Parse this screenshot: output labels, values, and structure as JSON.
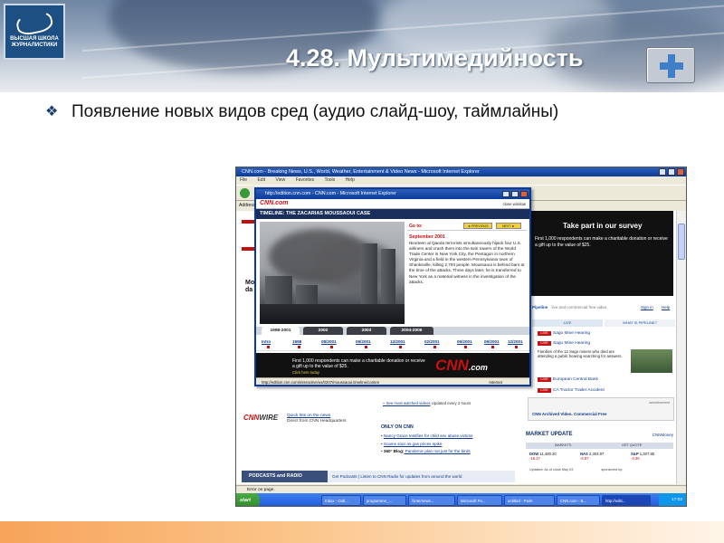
{
  "slide": {
    "logo_text": "ВЫСШАЯ ШКОЛА ЖУРНАЛИСТИКИ",
    "title": "4.28. Мультимедийность",
    "bullet_glyph": "❖",
    "bullet": "Появление новых видов сред (аудио слайд-шоу, таймлайны)"
  },
  "browser": {
    "title": "CNN.com - Breaking News, U.S., World, Weather, Entertainment & Video News - Microsoft Internet Explorer",
    "menu": [
      "File",
      "Edit",
      "View",
      "Favorites",
      "Tools",
      "Help"
    ],
    "address_label": "Address",
    "status": "Error on page."
  },
  "background_page": {
    "headline": "Mo da",
    "survey": {
      "title": "Take part in our survey",
      "text": "First 1,000 respondents can make a charitable donation or receive a gift up to the value of $25."
    },
    "pipeline": {
      "brand": "Pipeline",
      "tagline": "live and commercial free video",
      "signin": "Sign in",
      "help": "Help",
      "tab_live": "LIVE",
      "tab_what": "WHAT IS PIPELINE?",
      "items": [
        {
          "badge": "LIVE",
          "label": "Sago Mine Hearing"
        },
        {
          "badge": "LIVE",
          "label": "Sago Mine Hearing"
        },
        {
          "badge": "LIVE",
          "label": "European Central Bank"
        },
        {
          "badge": "LIVE",
          "label": "CA Tractor Trailer Accident"
        }
      ],
      "description": "Families of the 12 Sago miners who died are attending a public hearing searching for answers."
    },
    "archived": {
      "sponsored": "advertisement",
      "label": "CNN Archived Video. Commercial Free"
    },
    "market": {
      "title": "MARKET UPDATE",
      "link": "CNNMoney",
      "tab_markets": "MARKETS",
      "tab_quote": "GET QUOTE",
      "indices": [
        {
          "name": "DOW",
          "value": "11,480.20",
          "change": "-16.17"
        },
        {
          "name": "NAS",
          "value": "2,303.97",
          "change": "-5.87"
        },
        {
          "name": "S&P",
          "value": "1,307.85",
          "change": "-3.36"
        }
      ],
      "updated": "Updated: As of close May 03",
      "sponsored_by": "sponsored by:"
    },
    "wire": {
      "logo_cnn": "CNN",
      "logo_wire": "WIRE",
      "quick_hits": "Quick hits on the news",
      "direct": "Direct from CNN Headquarters"
    },
    "most_watched": {
      "link": "» See most watched videos",
      "updated": "Updated every 2 hours"
    },
    "only_on_cnn": {
      "title": "ONLY ON CNN",
      "items": [
        {
          "bold": "",
          "text": "Nancy Grace testifies for child sex abuse victims"
        },
        {
          "bold": "",
          "text": "Scams soar as gas prices spike"
        },
        {
          "bold": "360° Blog:",
          "text": " Pandemic plan not just for the birds"
        }
      ]
    },
    "podcasts": {
      "title": "PODCASTS and RADIO",
      "link": "Get Podcasts | Listen to CNN Radio for updates from around the world"
    }
  },
  "popup": {
    "title": "http://edition.cnn.com - CNN.com - Microsoft Internet Explorer",
    "logo": "CNN.com",
    "close": "close window",
    "heading": "TIMELINE: THE ZACARIAS MOUSSAOUI CASE",
    "goto": "Go to:",
    "prev": "◄ PREVIOUS",
    "next": "NEXT ►",
    "date": "September 2001",
    "text": "Nineteen al Qaeda terrorists simultaneously hijack four U.S. airliners and crash them into the twin towers of the World Trade Center in New York City, the Pentagon in northern Virginia and a field in the western Pennsylvania town of Shanksville, killing 2,793 people. Moussaoui is behind bars at the time of the attacks. Three days later, he is transferred to New York as a material witness in the investigation of the attacks.",
    "years": [
      "1998-2001",
      "2002",
      "2003",
      "2004-2006"
    ],
    "months": [
      "Intro",
      "1998",
      "08/2001",
      "09/2001",
      "12/2001",
      "02/2001",
      "06/2001",
      "09/2001",
      "12/2001"
    ],
    "ad_text": "First 1,000 respondents can make a charitable donation or receive a gift up to the value of $25.",
    "ad_link": "Click here today",
    "ad_logo_main": "CNN",
    "ad_logo_tld": ".com",
    "status_url": "http://edition.cnn.com/interactive/us/0207/moussaoui.timeline/conten",
    "status_zone": "Internet"
  },
  "taskbar": {
    "start": "start",
    "tasks": [
      "Inbox - Outl...",
      "programme_...",
      "\\\\internews...",
      "Microsoft Po...",
      "untitled - Paint",
      "CNN.com - B...",
      "http://editi..."
    ],
    "clock": "17:02"
  }
}
